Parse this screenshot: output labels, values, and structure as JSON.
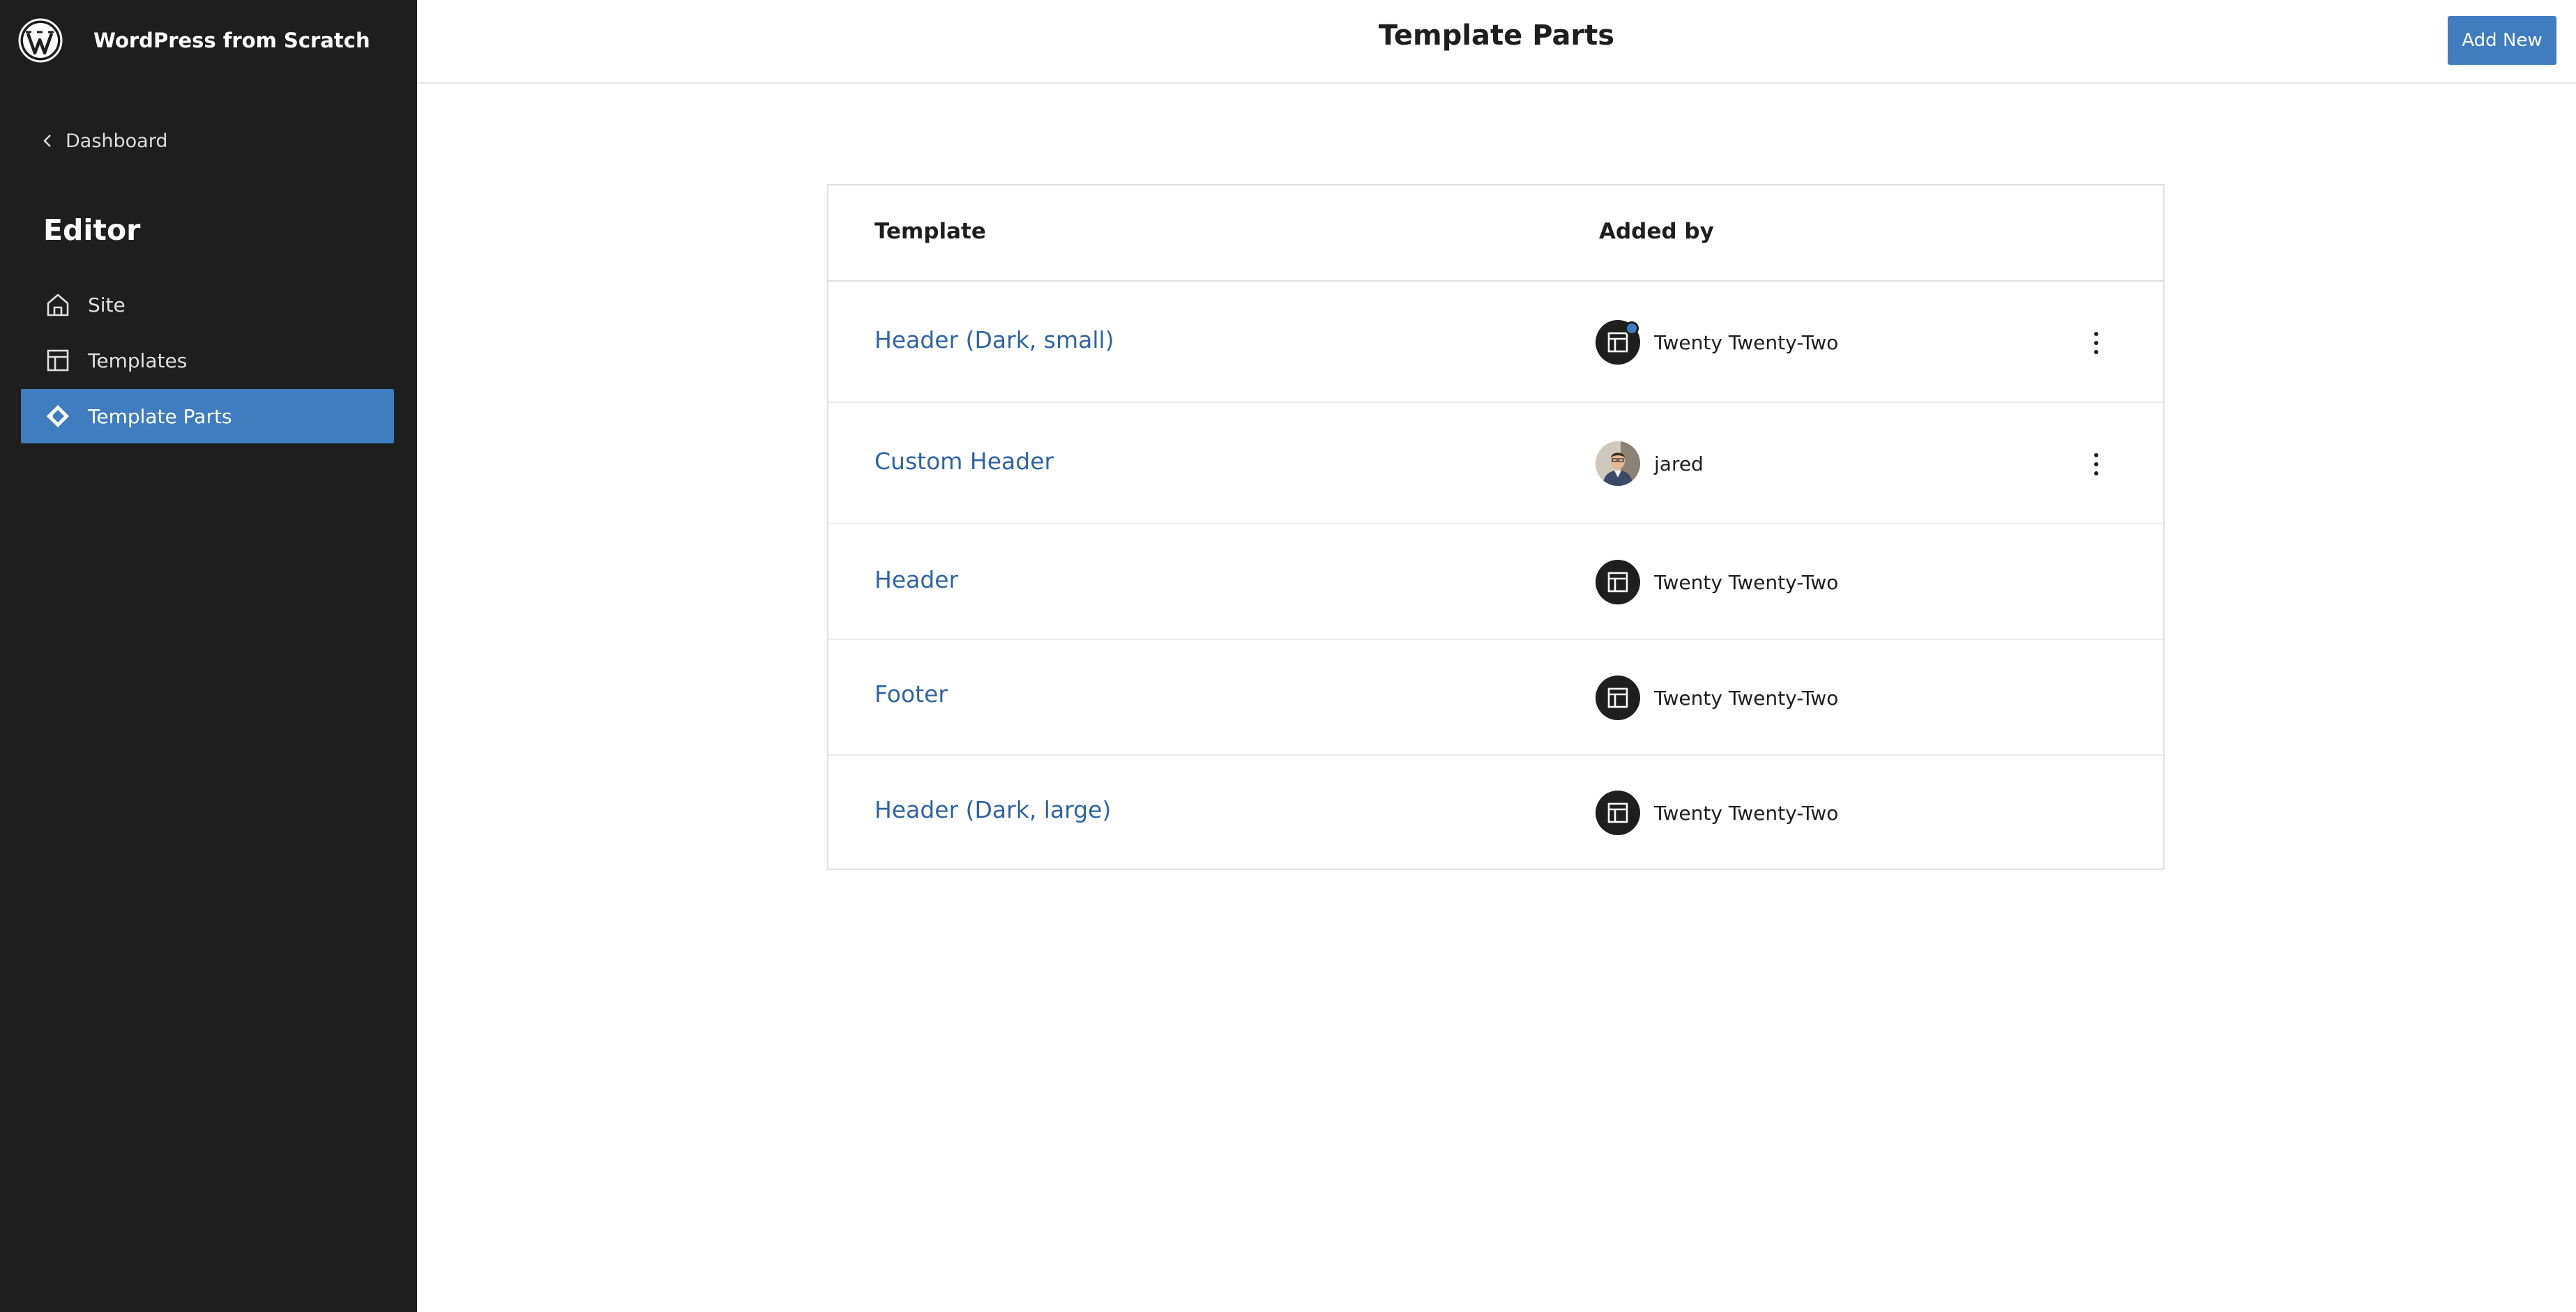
{
  "sidebar": {
    "site_title": "WordPress from Scratch",
    "logo_icon": "wordpress-logo-icon",
    "back_label": "Dashboard",
    "back_icon": "chevron-left-icon",
    "heading": "Editor",
    "items": [
      {
        "label": "Site",
        "icon": "home-icon",
        "active": false
      },
      {
        "label": "Templates",
        "icon": "layout-icon",
        "active": false
      },
      {
        "label": "Template Parts",
        "icon": "symbol-diamond-icon",
        "active": true
      }
    ]
  },
  "header": {
    "title": "Template Parts",
    "add_new_label": "Add New"
  },
  "table": {
    "columns": [
      "Template",
      "Added by"
    ],
    "rows": [
      {
        "title": "Header (Dark, small)",
        "added_by": "Twenty Twenty-Two",
        "avatar": "layout-icon",
        "modified_dot": true,
        "has_actions": true
      },
      {
        "title": "Custom Header",
        "added_by": "jared",
        "avatar": "user-photo",
        "modified_dot": false,
        "has_actions": true
      },
      {
        "title": "Header",
        "added_by": "Twenty Twenty-Two",
        "avatar": "layout-icon",
        "modified_dot": false,
        "has_actions": false
      },
      {
        "title": "Footer",
        "added_by": "Twenty Twenty-Two",
        "avatar": "layout-icon",
        "modified_dot": false,
        "has_actions": false
      },
      {
        "title": "Header (Dark, large)",
        "added_by": "Twenty Twenty-Two",
        "avatar": "layout-icon",
        "modified_dot": false,
        "has_actions": false
      }
    ]
  },
  "colors": {
    "sidebar_bg": "#1e1e1e",
    "accent": "#3f7cc0",
    "link": "#2f64a3"
  }
}
